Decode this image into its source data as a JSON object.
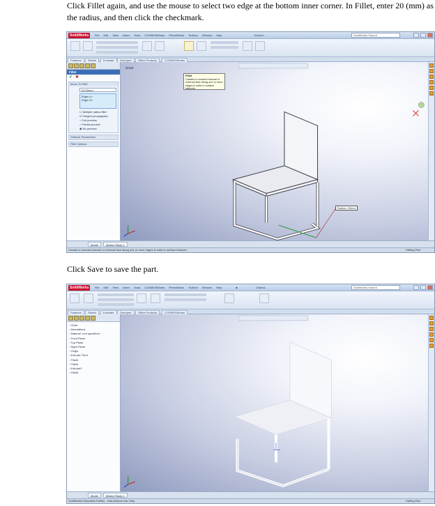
{
  "instructions": {
    "step1": "Click Fillet again, and use the mouse to select two edge at the bottom inner corner. In Fillet, enter 20 (mm) as the radius, and then click the checkmark.",
    "step2": "Click Save to save the part."
  },
  "screenshot1": {
    "app_logo": "SolidWorks",
    "menus": [
      "File",
      "Edit",
      "View",
      "Insert",
      "Tools",
      "COSMOSWorks",
      "PhotoWorks",
      "Toolbox",
      "Window",
      "Help"
    ],
    "doc_title": "Chair.sl...",
    "search_placeholder": "SolidWorks Search",
    "tabs": [
      "Features",
      "Sketch",
      "Evaluate",
      "DimXpert",
      "Office Products",
      "COSMOSWorks"
    ],
    "viewport_label": "Chair",
    "tooltip_title": "Fillet",
    "tooltip_text": "Creates a rounded internal or external face along one or more edges in solid or surface features.",
    "panel": {
      "title": "Fillet",
      "group_items": "Items To Fillet",
      "radius": "20.00mm",
      "edges": [
        "Edge<1>",
        "Edge<2>"
      ],
      "options": [
        "Multiple radius fillet",
        "Tangent propagation",
        "Full preview",
        "Partial preview",
        "No preview"
      ],
      "group_setback": "Setback Parameters",
      "group_fillet_options": "Fillet Options"
    },
    "callout": "Radius: 20mm",
    "bottom_tabs": [
      "Model",
      "Motion Study 1"
    ],
    "status_left": "Creates a rounded internal or external face along one or more edges in solid or surface features.",
    "status_right": "Editing Part"
  },
  "screenshot2": {
    "app_logo": "SolidWorks",
    "menus": [
      "File",
      "Edit",
      "View",
      "Insert",
      "Tools",
      "COSMOSWorks",
      "PhotoWorks",
      "Toolbox",
      "Window",
      "Help"
    ],
    "doc_title": "Chair.sl...",
    "search_placeholder": "SolidWorks Search",
    "ribbon_labels": [
      "Sketch",
      "Smart Dimension",
      "Trim Entities",
      "Convert Entities",
      "Mirror Entities",
      "Display/Delete Relations",
      "Rapid Sketch"
    ],
    "tabs": [
      "Features",
      "Sketch",
      "Evaluate",
      "DimXpert",
      "Office Products",
      "COSMOSWorks"
    ],
    "tree": [
      "Chair",
      "Annotations",
      "Material <not specified>",
      "Front Plane",
      "Top Plane",
      "Right Plane",
      "Origin",
      "Extrude-Thin1",
      "Fillet3",
      "Fillet4",
      "Extrude2",
      "Fillet5"
    ],
    "bottom_tabs": [
      "Model",
      "Motion Study 1"
    ],
    "status_left": "SolidWorks Education Edition - Instructional Use Only",
    "status_right": "Editing Part"
  }
}
